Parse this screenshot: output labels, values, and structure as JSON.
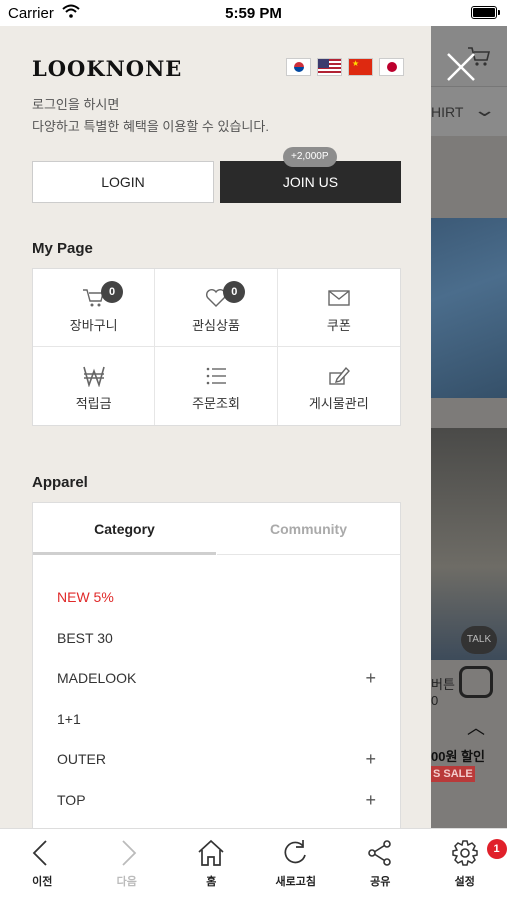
{
  "status_bar": {
    "carrier": "Carrier",
    "time": "5:59 PM"
  },
  "drawer": {
    "logo": "LOOKNONE",
    "flags": [
      "korea-flag",
      "usa-flag",
      "china-flag",
      "japan-flag"
    ],
    "login_message_line1": "로그인을 하시면",
    "login_message_line2": "다양하고 특별한 혜택을 이용할 수 있습니다.",
    "login_button": "LOGIN",
    "join_button": "JOIN US",
    "join_point_badge": "+2,000P",
    "my_page": {
      "title": "My Page",
      "items": [
        {
          "label": "장바구니",
          "icon": "cart-icon",
          "count": "0"
        },
        {
          "label": "관심상품",
          "icon": "heart-icon",
          "count": "0"
        },
        {
          "label": "쿠폰",
          "icon": "envelope-icon"
        },
        {
          "label": "적립금",
          "icon": "won-icon"
        },
        {
          "label": "주문조회",
          "icon": "list-icon"
        },
        {
          "label": "게시물관리",
          "icon": "edit-icon"
        }
      ]
    },
    "apparel": {
      "title": "Apparel",
      "tabs": {
        "category": "Category",
        "community": "Community"
      },
      "categories": [
        {
          "label": "NEW 5%",
          "expandable": false,
          "highlight": true
        },
        {
          "label": "BEST 30",
          "expandable": false
        },
        {
          "label": "MADELOOK",
          "expandable": true
        },
        {
          "label": "1+1",
          "expandable": false
        },
        {
          "label": "OUTER",
          "expandable": true
        },
        {
          "label": "TOP",
          "expandable": true
        }
      ],
      "expand_symbol": "+"
    }
  },
  "background_page": {
    "tab_text": "HIRT",
    "talk_label": "TALK",
    "product_text1": "버튼",
    "product_text2": "0",
    "price_text": "00원 할인",
    "sale_label": "S SALE"
  },
  "toolbar": {
    "items": [
      {
        "label": "이전",
        "icon": "back-icon",
        "enabled": true
      },
      {
        "label": "다음",
        "icon": "forward-icon",
        "enabled": false
      },
      {
        "label": "홈",
        "icon": "home-icon",
        "enabled": true
      },
      {
        "label": "새로고침",
        "icon": "refresh-icon",
        "enabled": true
      },
      {
        "label": "공유",
        "icon": "share-icon",
        "enabled": true
      },
      {
        "label": "설정",
        "icon": "settings-icon",
        "enabled": true,
        "badge": "1"
      }
    ]
  },
  "colors": {
    "drawer_bg": "#eeebe6",
    "join_bg": "#2a2a2a",
    "highlight_red": "#e02a2a",
    "badge_red": "#e0202a"
  }
}
